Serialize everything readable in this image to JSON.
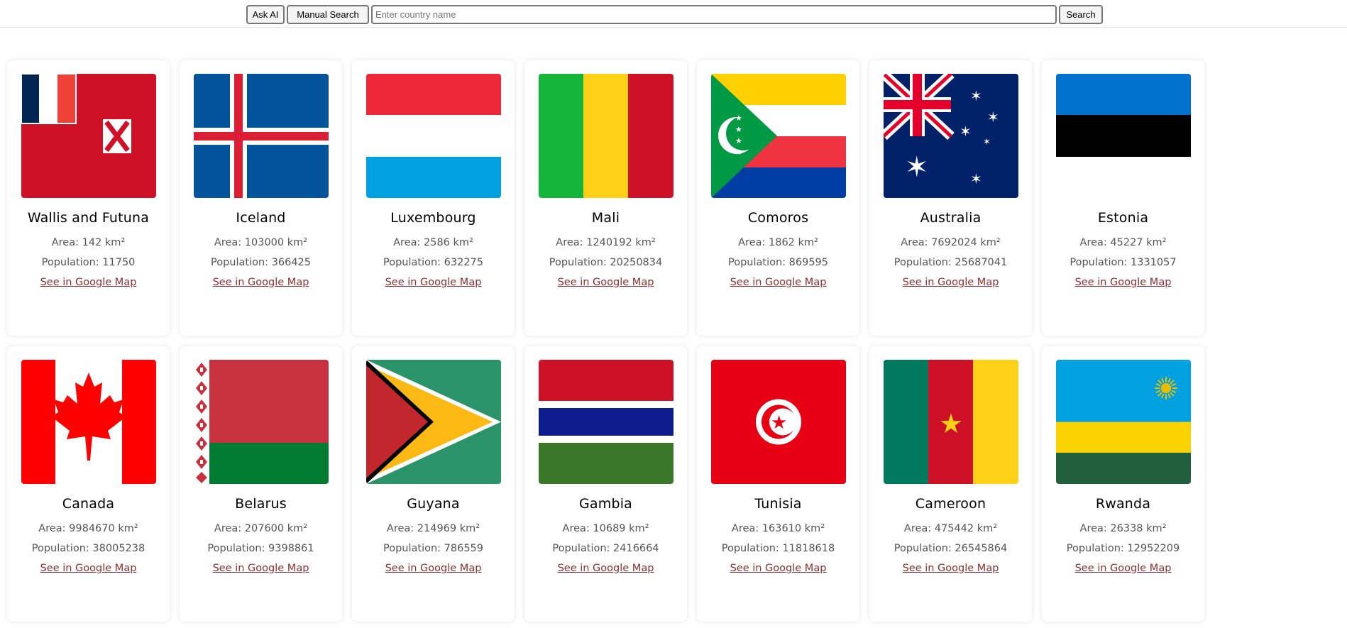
{
  "toolbar": {
    "ask_ai_label": "Ask AI",
    "manual_search_label": "Manual Search",
    "search_placeholder": "Enter country name",
    "search_value": "",
    "search_label": "Search"
  },
  "link_label": "See in Google Map",
  "countries": [
    {
      "name": "Wallis and Futuna",
      "area": "Area: 142 km²",
      "population": "Population: 11750"
    },
    {
      "name": "Iceland",
      "area": "Area: 103000 km²",
      "population": "Population: 366425"
    },
    {
      "name": "Luxembourg",
      "area": "Area: 2586 km²",
      "population": "Population: 632275"
    },
    {
      "name": "Mali",
      "area": "Area: 1240192 km²",
      "population": "Population: 20250834"
    },
    {
      "name": "Comoros",
      "area": "Area: 1862 km²",
      "population": "Population: 869595"
    },
    {
      "name": "Australia",
      "area": "Area: 7692024 km²",
      "population": "Population: 25687041"
    },
    {
      "name": "Estonia",
      "area": "Area: 45227 km²",
      "population": "Population: 1331057"
    },
    {
      "name": "Canada",
      "area": "Area: 9984670 km²",
      "population": "Population: 38005238"
    },
    {
      "name": "Belarus",
      "area": "Area: 207600 km²",
      "population": "Population: 9398861"
    },
    {
      "name": "Guyana",
      "area": "Area: 214969 km²",
      "population": "Population: 786559"
    },
    {
      "name": "Gambia",
      "area": "Area: 10689 km²",
      "population": "Population: 2416664"
    },
    {
      "name": "Tunisia",
      "area": "Area: 163610 km²",
      "population": "Population: 11818618"
    },
    {
      "name": "Cameroon",
      "area": "Area: 475442 km²",
      "population": "Population: 26545864"
    },
    {
      "name": "Rwanda",
      "area": "Area: 26338 km²",
      "population": "Population: 12952209"
    }
  ]
}
